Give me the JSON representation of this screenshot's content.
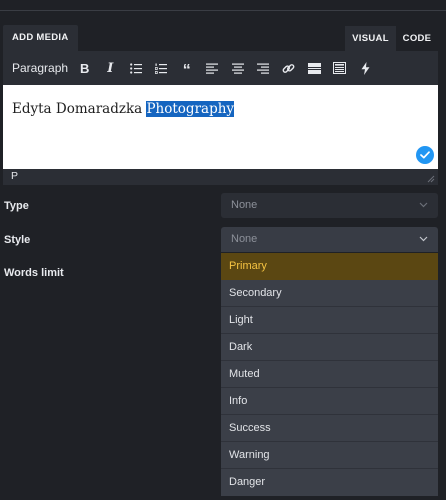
{
  "tabs": {
    "add_media": "ADD MEDIA",
    "visual": "VISUAL",
    "code": "CODE"
  },
  "toolbar": {
    "format": "Paragraph",
    "buttons": [
      "bold-icon",
      "italic-icon",
      "bullet-list-icon",
      "numbered-list-icon",
      "blockquote-icon",
      "align-left-icon",
      "align-center-icon",
      "align-right-icon",
      "link-icon",
      "read-more-icon",
      "toolbar-toggle-icon",
      "lightning-icon"
    ]
  },
  "editor": {
    "text_plain": "Edyta Domaradzka ",
    "text_selected": "Photography",
    "status_path": "P"
  },
  "form": {
    "type": {
      "label": "Type",
      "value": "None"
    },
    "style": {
      "label": "Style",
      "value": "None"
    },
    "words_limit": {
      "label": "Words limit"
    }
  },
  "dropdown": {
    "options": [
      "Primary",
      "Secondary",
      "Light",
      "Dark",
      "Muted",
      "Info",
      "Success",
      "Warning",
      "Danger"
    ],
    "highlighted": "Primary"
  },
  "colors": {
    "background": "#1f2126",
    "panel": "#2b2e35",
    "selection": "#1565c0",
    "accent_badge": "#2196f3",
    "dropdown_bg": "#3b3f48",
    "highlight_bg": "#5b4712",
    "highlight_text": "#f5c342"
  }
}
